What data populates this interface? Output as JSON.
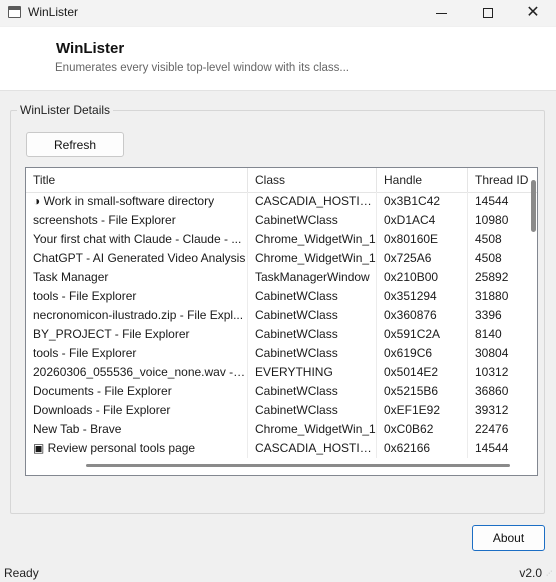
{
  "window": {
    "title": "WinLister",
    "icon": "app-window-icon"
  },
  "header": {
    "title": "WinLister",
    "subtitle": "Enumerates every visible top-level window with its class..."
  },
  "group": {
    "label": "WinLister Details"
  },
  "buttons": {
    "refresh": "Refresh",
    "about": "About"
  },
  "table": {
    "columns": [
      "Title",
      "Class",
      "Handle",
      "Thread ID"
    ],
    "rows": [
      [
        "◑ Work in small-software directory",
        "CASCADIA_HOSTIN...",
        "0x3B1C42",
        "14544"
      ],
      [
        "screenshots - File Explorer",
        "CabinetWClass",
        "0xD1AC4",
        "10980"
      ],
      [
        "Your first chat with Claude - Claude - ...",
        "Chrome_WidgetWin_1",
        "0x80160E",
        "4508"
      ],
      [
        "ChatGPT - AI Generated Video Analysis",
        "Chrome_WidgetWin_1",
        "0x725A6",
        "4508"
      ],
      [
        "Task Manager",
        "TaskManagerWindow",
        "0x210B00",
        "25892"
      ],
      [
        "tools - File Explorer",
        "CabinetWClass",
        "0x351294",
        "31880"
      ],
      [
        "necronomicon-ilustrado.zip - File Expl...",
        "CabinetWClass",
        "0x360876",
        "3396"
      ],
      [
        "BY_PROJECT - File Explorer",
        "CabinetWClass",
        "0x591C2A",
        "8140"
      ],
      [
        "tools - File Explorer",
        "CabinetWClass",
        "0x619C6",
        "30804"
      ],
      [
        "20260306_055536_voice_none.wav - Ev...",
        "EVERYTHING",
        "0x5014E2",
        "10312"
      ],
      [
        "Documents - File Explorer",
        "CabinetWClass",
        "0x5215B6",
        "36860"
      ],
      [
        "Downloads - File Explorer",
        "CabinetWClass",
        "0xEF1E92",
        "39312"
      ],
      [
        "New Tab - Brave",
        "Chrome_WidgetWin_1",
        "0xC0B62",
        "22476"
      ],
      [
        "▣ Review personal tools page",
        "CASCADIA_HOSTIN...",
        "0x62166",
        "14544"
      ]
    ]
  },
  "status": {
    "text": "Ready",
    "version": "v2.0"
  }
}
